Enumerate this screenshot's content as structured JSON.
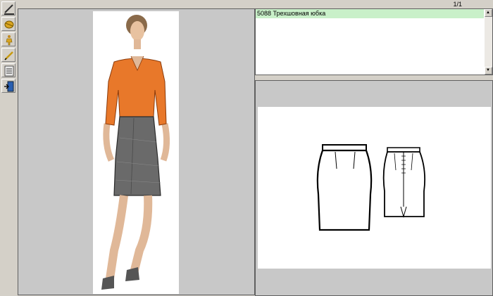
{
  "toolbar": {
    "buttons": [
      {
        "icon": "pencil-line-icon"
      },
      {
        "icon": "fabric-roll-icon"
      },
      {
        "icon": "figure-icon"
      },
      {
        "icon": "pen-icon"
      },
      {
        "icon": "document-list-icon"
      },
      {
        "icon": "exit-door-icon"
      }
    ]
  },
  "header": {
    "page_counter": "1/1"
  },
  "model_list": {
    "items": [
      {
        "label": "5088 Трехшовная юбка"
      }
    ]
  },
  "colors": {
    "selected_row": "#c9f0c9",
    "panel_bg": "#c8c8c8",
    "window_bg": "#d4d0c8",
    "blouse": "#e8782a",
    "skirt": "#6a6a6a"
  }
}
